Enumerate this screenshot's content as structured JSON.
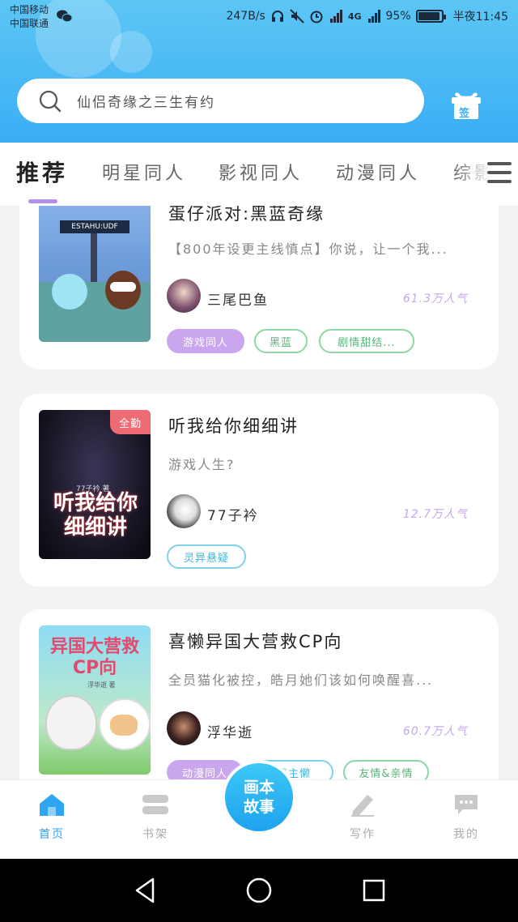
{
  "status_bar": {
    "carrier_1": "中国移动",
    "carrier_2": "中国联通",
    "speed": "247B/s",
    "network": "4G",
    "battery": "95%",
    "battery_level": 0.95,
    "time": "半夜11:45"
  },
  "search": {
    "placeholder": "仙侣奇缘之三生有约"
  },
  "gift": {
    "label": "签"
  },
  "tabs": [
    {
      "label": "推荐",
      "active": true
    },
    {
      "label": "明星同人"
    },
    {
      "label": "影视同人"
    },
    {
      "label": "动漫同人"
    },
    {
      "label": "综影"
    }
  ],
  "books": [
    {
      "title": "蛋仔派对:黑蓝奇缘",
      "description": "【800年设更主线慎点】你说，让一个我...",
      "author": "三尾巴鱼",
      "popularity": "61.3万人气",
      "cover_caption": "ESTAHU:UDF",
      "tags": [
        {
          "label": "游戏同人",
          "style": "purple"
        },
        {
          "label": "黑蓝",
          "style": "green"
        },
        {
          "label": "剧情甜结...",
          "style": "green"
        }
      ]
    },
    {
      "title": "听我给你细细讲",
      "description": "游戏人生?",
      "author": "77子衿",
      "popularity": "12.7万人气",
      "badge": "全勤",
      "cover_title": "听我给你细细讲",
      "cover_author": "77子衿 著",
      "tags": [
        {
          "label": "灵异悬疑",
          "style": "blue"
        }
      ]
    },
    {
      "title": "喜懒异国大营救CP向",
      "description": "全员猫化被控，皓月她们该如何唤醒喜...",
      "author": "浮华逝",
      "popularity": "60.7万人气",
      "cover_title": "异国大营救CP向",
      "cover_author": "浮华逝 著",
      "tags": [
        {
          "label": "动漫同人",
          "style": "purple"
        },
        {
          "label": "喜主懒",
          "style": "blue"
        },
        {
          "label": "友情&亲情",
          "style": "green"
        }
      ]
    }
  ],
  "bottom_nav": {
    "items": [
      {
        "label": "首页",
        "icon": "home-icon",
        "active": true
      },
      {
        "label": "书架",
        "icon": "bookshelf-icon"
      },
      {
        "label": "写作",
        "icon": "pen-icon"
      },
      {
        "label": "我的",
        "icon": "chat-bubble-icon"
      }
    ],
    "center_label": "画本故事"
  },
  "colors": {
    "header_top": "#5cc6f4",
    "header_bottom": "#3aaef5",
    "accent_purple": "#c9a6ee",
    "nav_active": "#2fa4f0",
    "badge_red": "#ef6b74"
  }
}
